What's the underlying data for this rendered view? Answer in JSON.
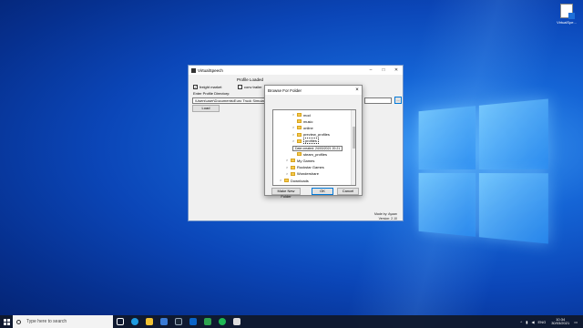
{
  "desktop": {
    "icon_label": "VirtualSpe..."
  },
  "app": {
    "title": "VirtualSpeech",
    "profile_loaded": "Profile Loaded",
    "freight_market": "freight market",
    "conv_trailer": "conv trailer",
    "enter_dir_label": "Enter Profile Directory:",
    "dir_value": "\\Users\\user\\Documents\\Euro Truck Simulator 2\\profiles",
    "browse_label": "...",
    "load_label": "Load",
    "made_by": "Made by: Ayaan",
    "version": "Version: 2.10"
  },
  "dialog": {
    "title": "Browse For Folder",
    "items": [
      {
        "label": "mod",
        "arrow": ">",
        "indent": 1
      },
      {
        "label": "music",
        "arrow": "",
        "indent": 1
      },
      {
        "label": "online",
        "arrow": ">",
        "indent": 1
      },
      {
        "label": "preview_profiles",
        "arrow": ">",
        "indent": 1
      },
      {
        "label": "profiles",
        "arrow": ">",
        "indent": 1,
        "selected": true
      },
      {
        "label": "screenshot",
        "arrow": "",
        "indent": 1
      },
      {
        "label": "steam_profiles",
        "arrow": "",
        "indent": 1
      },
      {
        "label": "My Games",
        "arrow": ">",
        "indent": 0
      },
      {
        "label": "Rockstar Games",
        "arrow": ">",
        "indent": 0
      },
      {
        "label": "Wondershare",
        "arrow": ">",
        "indent": 0
      },
      {
        "label": "Downloads",
        "arrow": ">",
        "indent": -1
      }
    ],
    "tooltip": "Date created: 24/03/2021 20:21",
    "make_new_folder": "Make New Folder",
    "ok": "OK",
    "cancel": "Cancel"
  },
  "taskbar": {
    "search_placeholder": "Type here to search",
    "time": "10:34",
    "date": "30/03/2021",
    "lang": "ENG",
    "apps": [
      "task-view",
      "edge",
      "file-explorer",
      "store",
      "steam",
      "mail",
      "game",
      "spotify",
      "app"
    ]
  }
}
